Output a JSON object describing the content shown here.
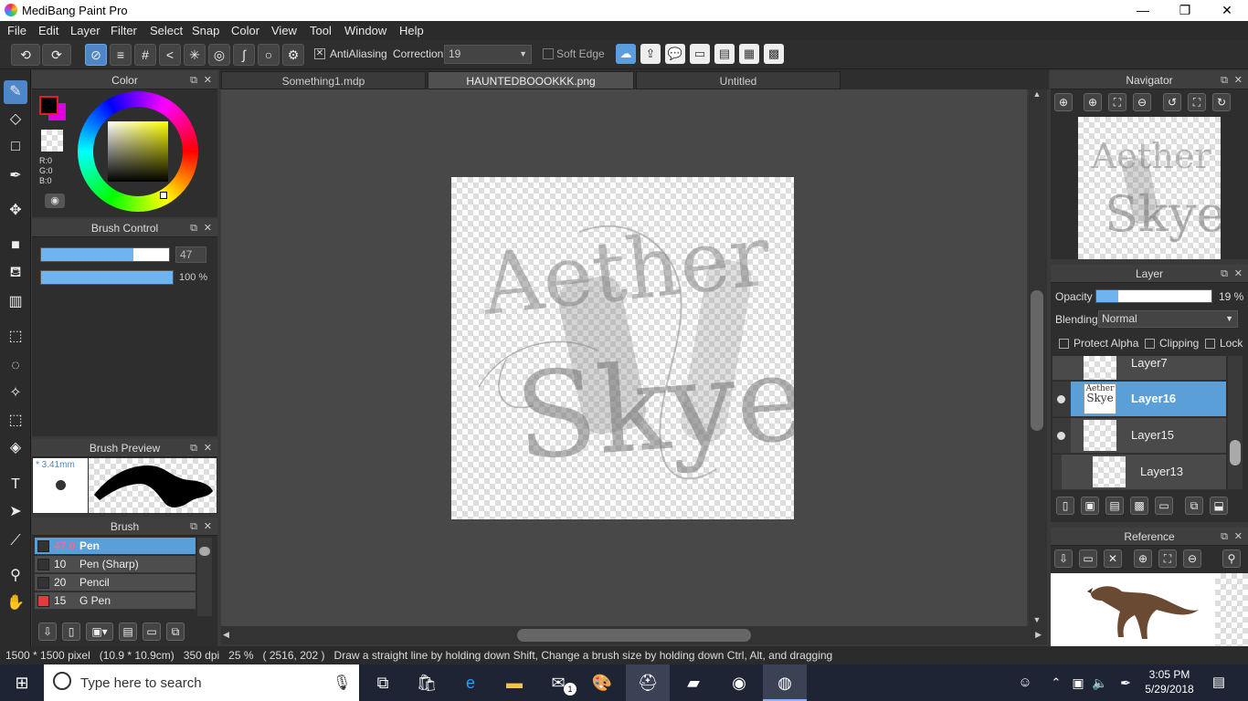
{
  "app": {
    "title": "MediBang Paint Pro"
  },
  "window": {
    "minimize": "—",
    "maximize": "❐",
    "close": "✕"
  },
  "menu": [
    "File",
    "Edit",
    "Layer",
    "Filter",
    "Select",
    "Snap",
    "Color",
    "View",
    "Window",
    "Help",
    "Tool"
  ],
  "toolbar": {
    "antialias": "AntiAliasing",
    "correction_label": "Correction",
    "correction_value": "19",
    "soft_edge": "Soft Edge"
  },
  "panels": {
    "color": {
      "title": "Color",
      "r": "R:0",
      "g": "G:0",
      "b": "B:0"
    },
    "brush_control": {
      "title": "Brush Control",
      "size": "47",
      "opacity": "100 %",
      "size_fraction": 0.47,
      "opacity_fraction": 1.0
    },
    "brush_preview": {
      "title": "Brush Preview",
      "size": "* 3.41mm"
    },
    "brush": {
      "title": "Brush",
      "items": [
        {
          "size": "47.0",
          "name": "Pen",
          "selected": true
        },
        {
          "size": "10",
          "name": "Pen (Sharp)"
        },
        {
          "size": "20",
          "name": "Pencil"
        },
        {
          "size": "15",
          "name": "G Pen"
        }
      ]
    },
    "navigator": {
      "title": "Navigator"
    },
    "layer": {
      "title": "Layer",
      "opacity_label": "Opacity",
      "opacity_value": "19 %",
      "opacity_fraction": 0.19,
      "blending_label": "Blending",
      "blending_value": "Normal",
      "protect_alpha": "Protect Alpha",
      "clipping": "Clipping",
      "lock": "Lock",
      "layers": [
        {
          "name": "Layer7"
        },
        {
          "name": "Layer16",
          "selected": true
        },
        {
          "name": "Layer15"
        },
        {
          "name": "Layer13"
        }
      ]
    },
    "reference": {
      "title": "Reference"
    }
  },
  "tabs": [
    {
      "label": "Something1.mdp"
    },
    {
      "label": "HAUNTEDBOOOKKK.png",
      "active": true
    },
    {
      "label": "Untitled"
    }
  ],
  "canvas": {
    "text_top": "Aether",
    "text_bottom": "Skye"
  },
  "status": {
    "text": "1500 * 1500 pixel   (10.9 * 10.9cm)   350 dpi   25 %   ( 2516, 202 )   Draw a straight line by holding down Shift, Change a brush size by holding down Ctrl, Alt, and dragging"
  },
  "taskbar": {
    "search_placeholder": "Type here to search",
    "time": "3:05 PM",
    "date": "5/29/2018",
    "mail_badge": "1"
  },
  "colors": {
    "accent": "#4e86c8",
    "selected_row": "#5a9fd8",
    "fg": "#000000",
    "bg": "#e000e0"
  }
}
